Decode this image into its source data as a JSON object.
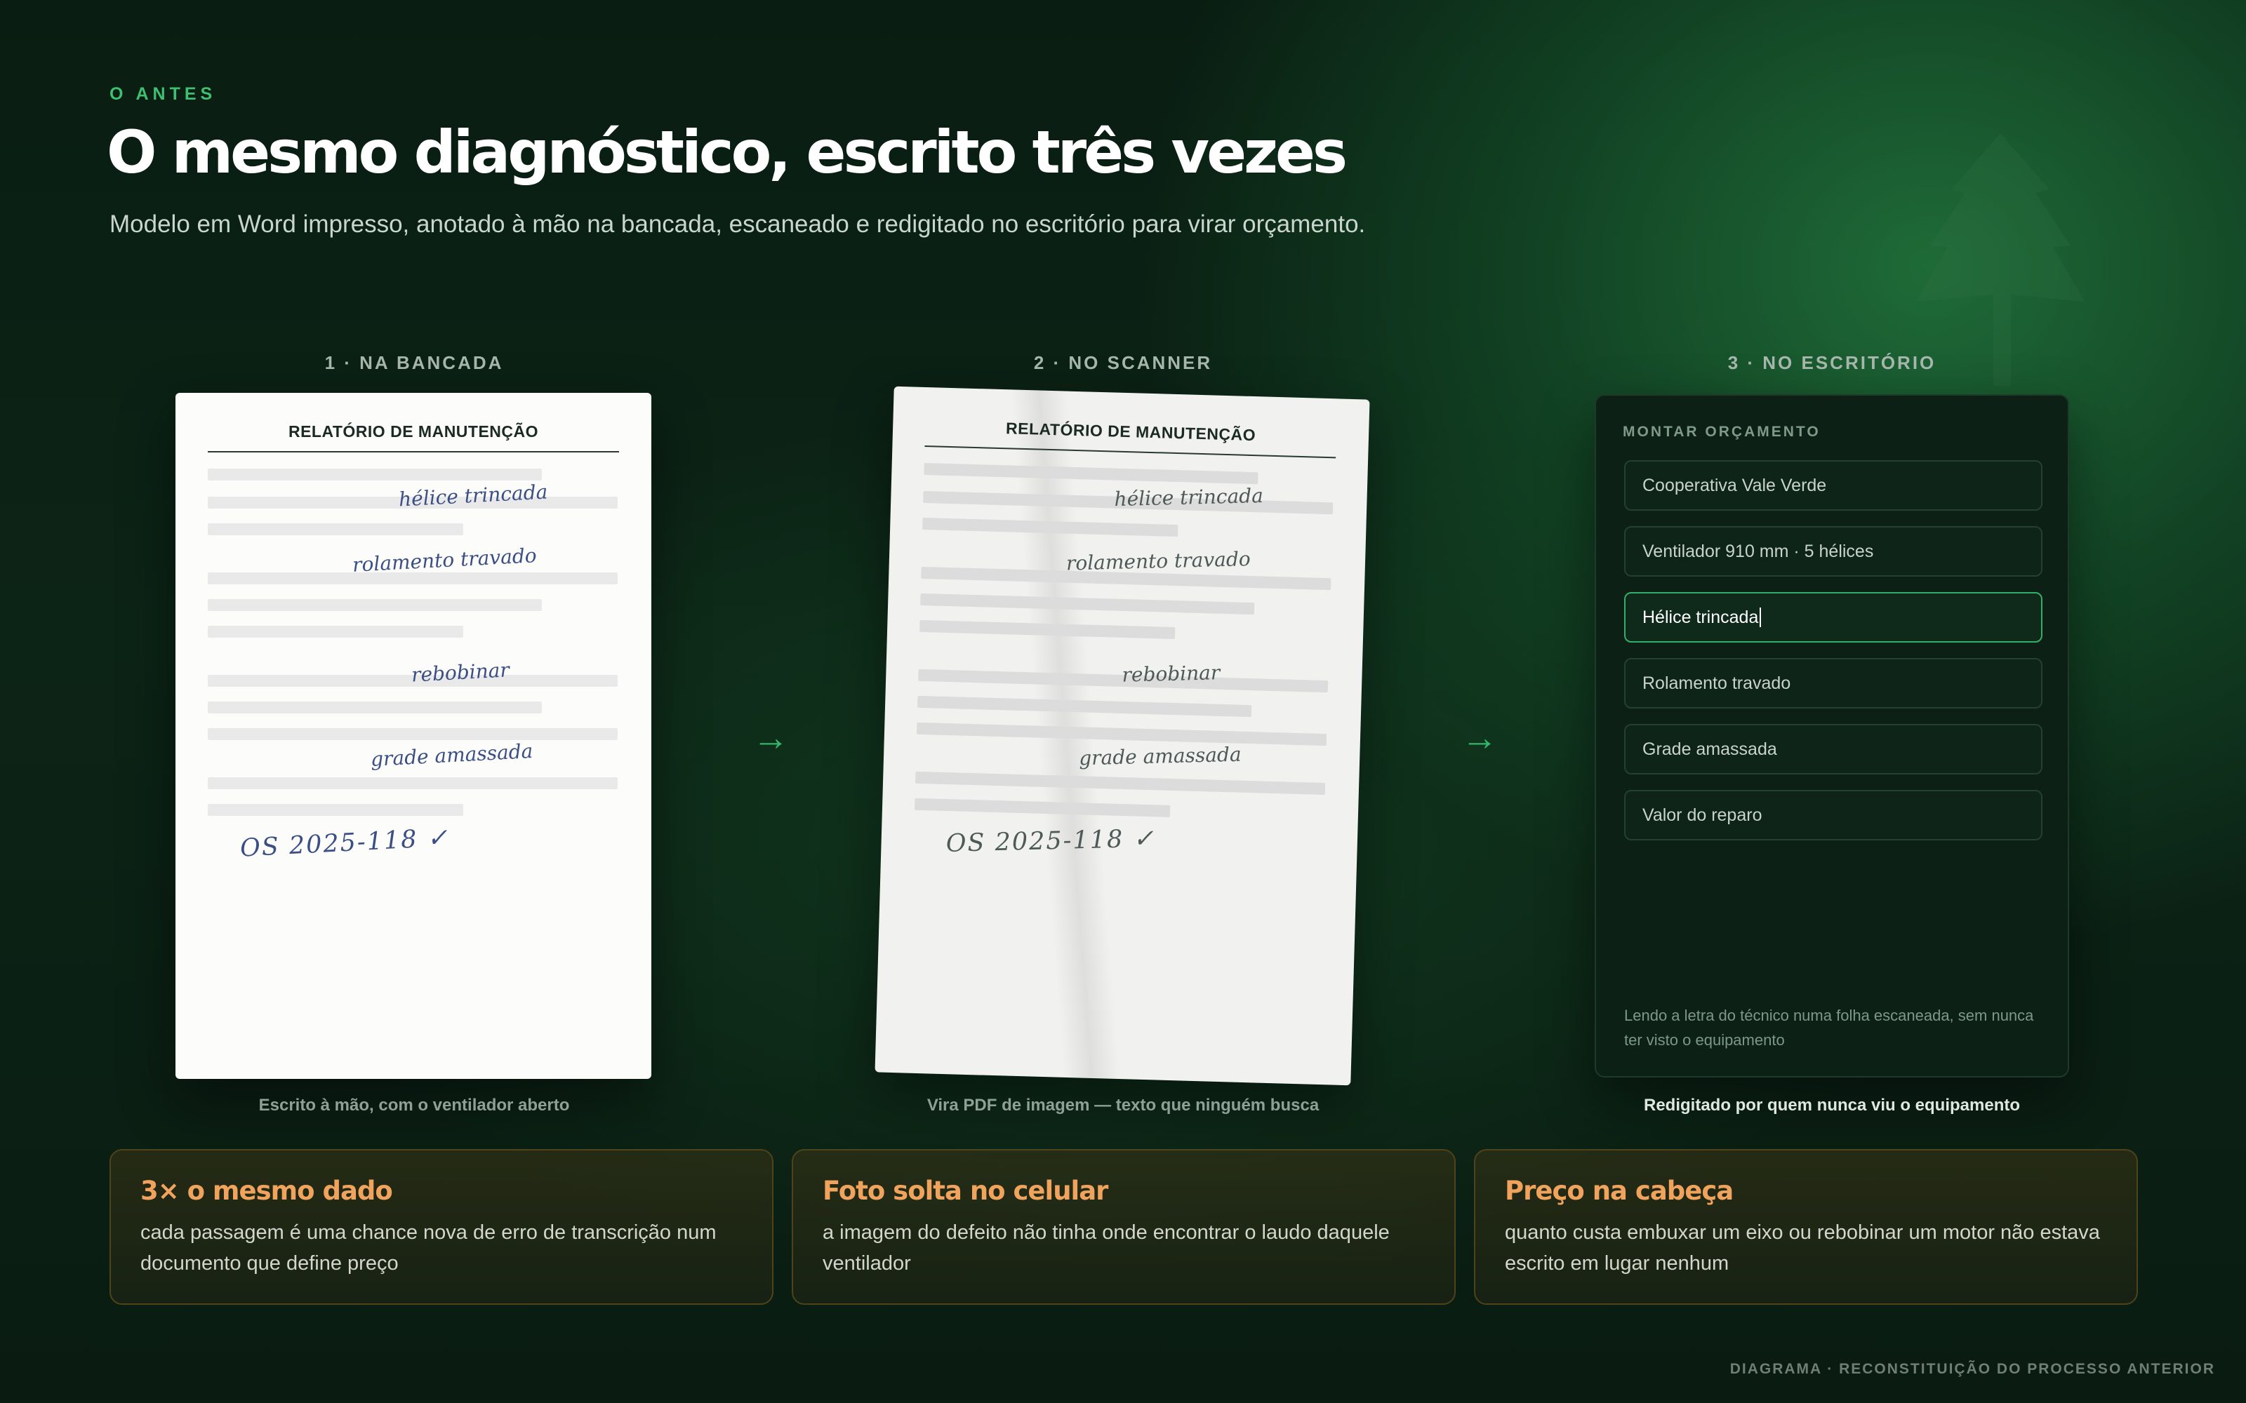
{
  "header": {
    "eyebrow": "O ANTES",
    "title": "O mesmo diagnóstico, escrito três vezes",
    "subtitle": "Modelo em Word impresso, anotado à mão na bancada, escaneado e redigitado no escritório para virar orçamento."
  },
  "arrows": [
    "→",
    "→"
  ],
  "steps": [
    {
      "label": "1 · NA BANCADA",
      "caption": "Escrito à mão, com o ventilador aberto",
      "sheet_title": "RELATÓRIO DE MANUTENÇÃO",
      "notes": [
        "hélice trincada",
        "rolamento travado",
        "rebobinar",
        "grade amassada",
        "OS 2025-118 ✓"
      ]
    },
    {
      "label": "2 · NO SCANNER",
      "caption": "Vira PDF de imagem — texto que ninguém busca",
      "sheet_title": "RELATÓRIO DE MANUTENÇÃO",
      "notes": [
        "hélice trincada",
        "rolamento travado",
        "rebobinar",
        "grade amassada",
        "OS 2025-118 ✓"
      ]
    },
    {
      "label": "3 · NO ESCRITÓRIO",
      "caption": "Redigitado por quem nunca viu o equipamento",
      "form_title": "MONTAR ORÇAMENTO",
      "fields": [
        "Cooperativa Vale Verde",
        "Ventilador 910 mm · 5 hélices",
        "Hélice trincada",
        "Rolamento travado",
        "Grade amassada",
        "Valor do reparo"
      ],
      "note": "Lendo a letra do técnico numa folha escaneada, sem nunca ter visto o equipamento"
    }
  ],
  "cards": [
    {
      "title": "3× o mesmo dado",
      "text": "cada passagem é uma chance nova de erro de transcrição num documento que define preço"
    },
    {
      "title": "Foto solta no celular",
      "text": "a imagem do defeito não tinha onde encontrar o laudo daquele ventilador"
    },
    {
      "title": "Preço na cabeça",
      "text": "quanto custa embuxar um eixo ou rebobinar um motor não estava escrito em lugar nenhum"
    }
  ],
  "footer": "DIAGRAMA · RECONSTITUIÇÃO DO PROCESSO ANTERIOR",
  "colors": {
    "accent_green": "#3fbf72",
    "card_title": "#f0a35c",
    "card_border": "#4e4319",
    "ink_blue": "#3b4f86"
  }
}
